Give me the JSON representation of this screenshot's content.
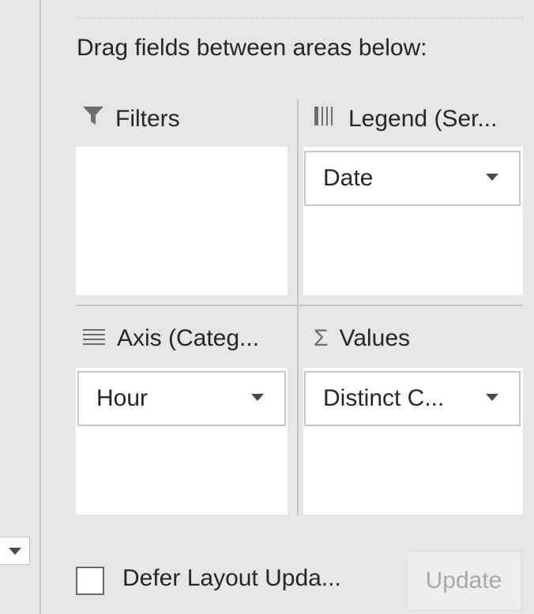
{
  "instruction": "Drag fields between areas below:",
  "areas": {
    "filters": {
      "title": "Filters",
      "icon": "filter-icon",
      "fields": []
    },
    "legend": {
      "title": "Legend (Ser...",
      "icon": "columns-icon",
      "fields": [
        {
          "label": "Date"
        }
      ]
    },
    "axis": {
      "title": "Axis (Categ...",
      "icon": "rows-icon",
      "fields": [
        {
          "label": "Hour"
        }
      ]
    },
    "values": {
      "title": "Values",
      "icon": "sigma-icon",
      "fields": [
        {
          "label": "Distinct C..."
        }
      ]
    }
  },
  "footer": {
    "defer_label": "Defer Layout Upda...",
    "defer_checked": false,
    "update_label": "Update",
    "update_enabled": false
  },
  "icon_glyphs": {
    "sigma": "Σ"
  }
}
